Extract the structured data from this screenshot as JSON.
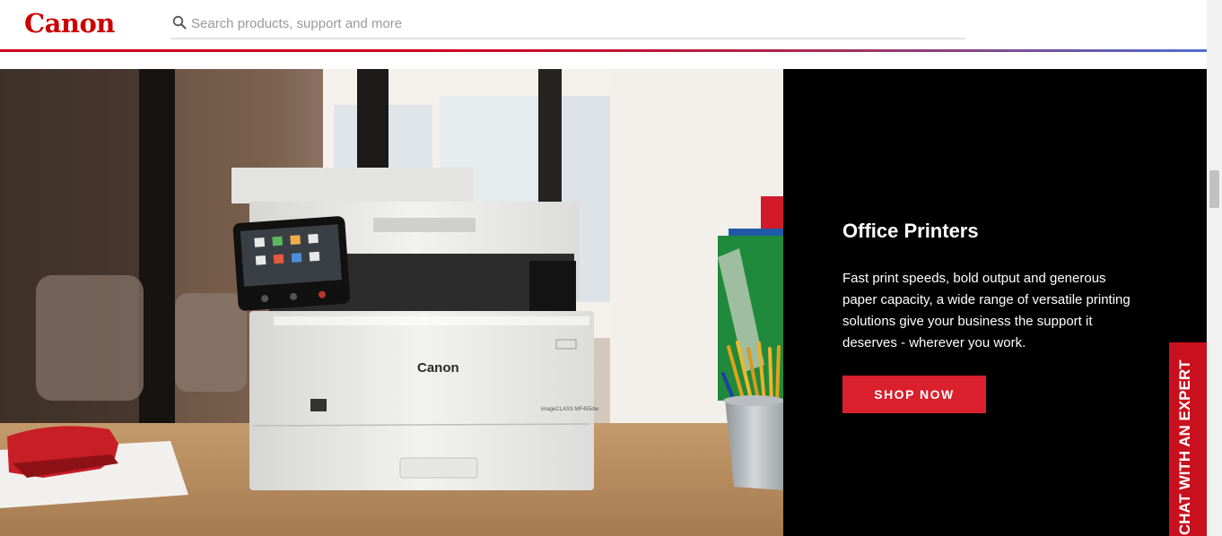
{
  "brand": {
    "logo_text": "Canon",
    "accent": "#cc0000"
  },
  "search": {
    "placeholder": "Search products, support and more",
    "icon": "search-icon"
  },
  "hero": {
    "title": "Office Printers",
    "description": "Fast print speeds, bold output and generous paper capacity, a wide range of versatile printing solutions give your business the support it deserves - wherever you work.",
    "cta_label": "SHOP NOW",
    "cta_color": "#d9202c",
    "panel_color": "#000000",
    "image": {
      "printer_logo": "Canon",
      "printer_model": "imageCLASS MF455dw"
    }
  },
  "chat": {
    "label": "CHAT WITH AN EXPERT",
    "color": "#c8101e"
  }
}
